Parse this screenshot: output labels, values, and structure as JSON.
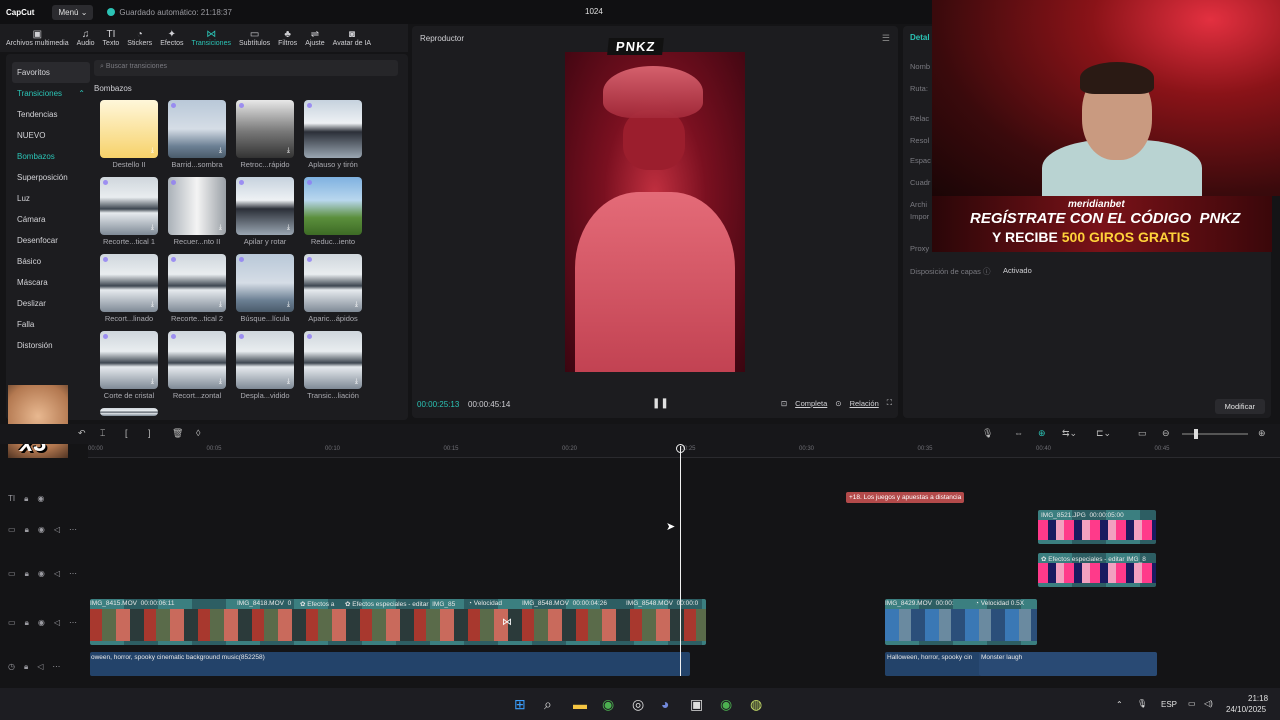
{
  "titlebar": {
    "logo": "CapCut",
    "menu": "Menú",
    "autosave": "Guardado automático: 21:18:37",
    "project": "1024"
  },
  "toolbar": [
    {
      "icon": "media-icon",
      "glyph": "▣",
      "label": "Archivos multimedia"
    },
    {
      "icon": "audio-icon",
      "glyph": "♫",
      "label": "Audio"
    },
    {
      "icon": "text-icon",
      "glyph": "TI",
      "label": "Texto"
    },
    {
      "icon": "sticker-icon",
      "glyph": "◔",
      "label": "Stickers"
    },
    {
      "icon": "effects-icon",
      "glyph": "✦",
      "label": "Efectos"
    },
    {
      "icon": "transitions-icon",
      "glyph": "⋈",
      "label": "Transiciones"
    },
    {
      "icon": "subtitles-icon",
      "glyph": "▭",
      "label": "Subtítulos"
    },
    {
      "icon": "filters-icon",
      "glyph": "♣",
      "label": "Filtros"
    },
    {
      "icon": "adjust-icon",
      "glyph": "⇌",
      "label": "Ajuste"
    },
    {
      "icon": "ai-avatar-icon",
      "glyph": "◙",
      "label": "Avatar de IA"
    }
  ],
  "categories": {
    "favorites": "Favoritos",
    "transitions": "Transiciones",
    "items": [
      "Tendencias",
      "NUEVO",
      "Bombazos",
      "Superposición",
      "Luz",
      "Cámara",
      "Desenfocar",
      "Básico",
      "Máscara",
      "Deslizar",
      "Falla",
      "Distorsión"
    ],
    "selected": "Bombazos"
  },
  "search": {
    "placeholder": "Buscar transiciones"
  },
  "section": "Bombazos",
  "transitions": [
    "Destello II",
    "Barrid...sombra",
    "Retroc...rápido",
    "Aplauso y tirón",
    "Recorte...tical 1",
    "Recuer...nto II",
    "Apilar y rotar",
    "Reduc...iento",
    "Recort...linado",
    "Recorte...tical 2",
    "Búsque...lícula",
    "Aparic...ápidos",
    "Corte de cristal",
    "Recort...zontal",
    "Despla...vidido",
    "Transic...liación"
  ],
  "player": {
    "title": "Reproductor",
    "overlay": "PNKZ",
    "current_time": "00:00:25:13",
    "total_time": "00:00:45:14",
    "full": "Completa",
    "ratio": "Relación"
  },
  "details": {
    "title": "Detal",
    "labels": [
      "Nomb",
      "Ruta:",
      "Relac",
      "Resol",
      "Espac",
      "Cuadr",
      "Archi",
      "Impor",
      "Proxy"
    ],
    "layer_label": "Disposición de capas",
    "layer_value": "Activado",
    "modify": "Modificar"
  },
  "banner": {
    "brand": "meridianbet",
    "line1": "REGÍSTRATE CON EL CÓDIGO",
    "code": "PNKZ",
    "line2a": "Y RECIBE",
    "line2b": "500 GIROS GRATIS"
  },
  "meme": {
    "text": "x3"
  },
  "ruler": [
    "00:00",
    "00:05",
    "00:10",
    "00:15",
    "00:20",
    "00:25",
    "00:30",
    "00:35",
    "00:40",
    "00:45"
  ],
  "clips": {
    "text": "+18. Los juegos y apuestas a distancia",
    "img_jpg": "IMG_8521.JPG",
    "img_jpg_dur": "00:00:05:00",
    "fx1": "Efectos especiales - editar",
    "fx1b": "IMG_8",
    "v1": "IMG_8415.MOV",
    "v1_dur": "00:00:06:11",
    "v2": "IMG_8418.MOV",
    "v2b": "0",
    "v3": "Efectos a",
    "v4": "Efectos especiales - editar",
    "v4b": "IMG_85",
    "v5": "Velocidad",
    "v6": "IMG_8548.MOV",
    "v6_dur": "00:00:04:26",
    "v7": "IMG_8548.MOV",
    "v7_dur": "00:00:0",
    "v8": "IMG_8429.MOV",
    "v8_dur": "00:00:",
    "v9": "Velocidad 0.5X",
    "a1": "oween, horror, spooky cinematic background music(852258)",
    "a2": "Halloween, horror, spooky cin",
    "a3": "Monster laugh"
  },
  "taskbar": {
    "lang": "ESP",
    "time": "21:18",
    "date": "24/10/2025"
  }
}
